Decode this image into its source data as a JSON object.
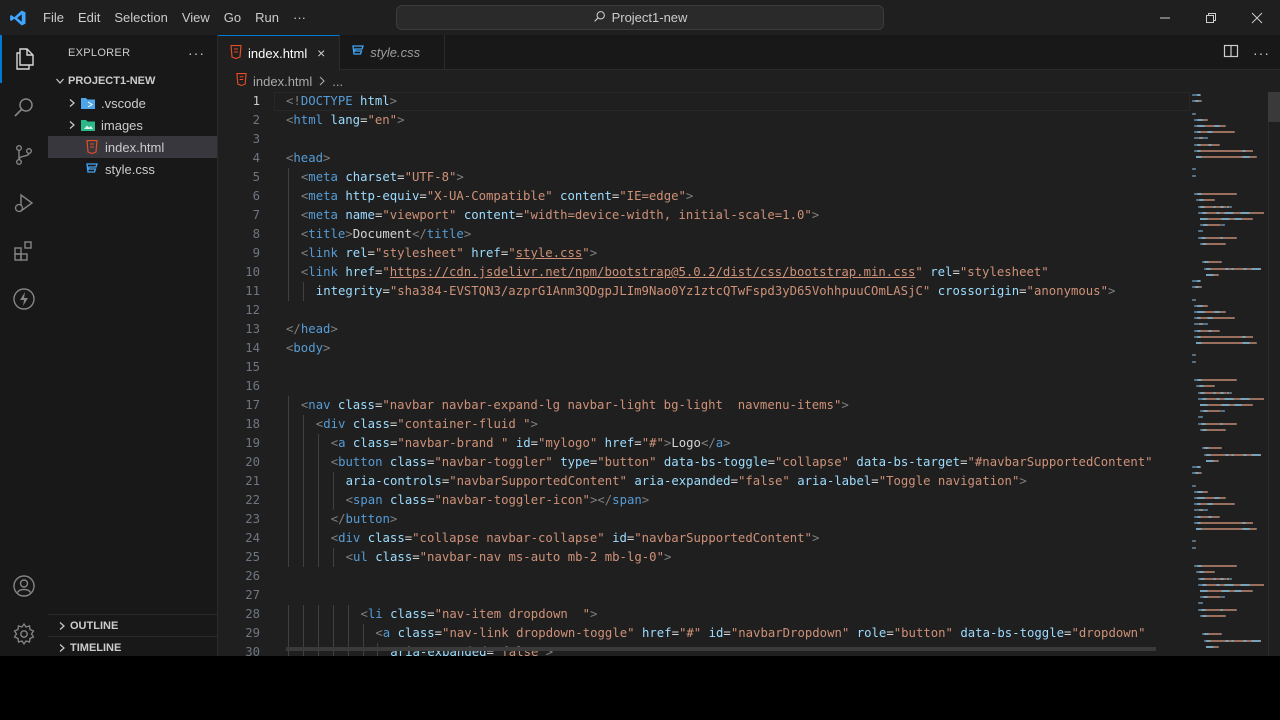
{
  "titlebar": {
    "menu": [
      "File",
      "Edit",
      "Selection",
      "View",
      "Go",
      "Run",
      "···"
    ],
    "search_text": "Project1-new",
    "logo_icon": "vscode-logo",
    "window_controls": [
      "minimize-icon",
      "restore-icon",
      "close-icon"
    ]
  },
  "activity_bar": {
    "items": [
      "explorer-icon",
      "search-icon",
      "source-control-icon",
      "run-debug-icon",
      "extensions-icon",
      "thunder-client-icon"
    ],
    "bottom_items": [
      "accounts-icon",
      "settings-gear-icon"
    ],
    "active_color": "#0078d4"
  },
  "explorer": {
    "title": "EXPLORER",
    "more": "···",
    "folder": "PROJECT1-NEW",
    "items": [
      {
        "label": ".vscode",
        "type": "folder",
        "icon": "vscode-folder-icon"
      },
      {
        "label": "images",
        "type": "folder",
        "icon": "images-folder-icon"
      },
      {
        "label": "index.html",
        "type": "file",
        "icon": "html-file-icon",
        "selected": true
      },
      {
        "label": "style.css",
        "type": "file",
        "icon": "css-file-icon"
      }
    ],
    "outline": "OUTLINE",
    "timeline": "TIMELINE"
  },
  "tabs": [
    {
      "label": "index.html",
      "active": true,
      "close": "×"
    },
    {
      "label": "style.css",
      "active": false
    }
  ],
  "breadcrumb": {
    "file": "index.html",
    "rest": "..."
  },
  "code": {
    "current_line": 1,
    "lines": [
      {
        "n": "1",
        "indent": 0,
        "tokens": [
          [
            "t",
            "<!"
          ],
          [
            "n",
            "DOCTYPE"
          ],
          [
            "x",
            " "
          ],
          [
            "a",
            "html"
          ],
          [
            "t",
            ">"
          ]
        ]
      },
      {
        "n": "2",
        "indent": 0,
        "tokens": [
          [
            "t",
            "<"
          ],
          [
            "n",
            "html"
          ],
          [
            "x",
            " "
          ],
          [
            "a",
            "lang"
          ],
          [
            "x",
            "="
          ],
          [
            "s",
            "\"en\""
          ],
          [
            "t",
            ">"
          ]
        ]
      },
      {
        "n": "3",
        "indent": 0,
        "tokens": []
      },
      {
        "n": "4",
        "indent": 0,
        "tokens": [
          [
            "t",
            "<"
          ],
          [
            "n",
            "head"
          ],
          [
            "t",
            ">"
          ]
        ]
      },
      {
        "n": "5",
        "indent": 1,
        "tokens": [
          [
            "t",
            "<"
          ],
          [
            "n",
            "meta"
          ],
          [
            "x",
            " "
          ],
          [
            "a",
            "charset"
          ],
          [
            "x",
            "="
          ],
          [
            "s",
            "\"UTF-8\""
          ],
          [
            "t",
            ">"
          ]
        ]
      },
      {
        "n": "6",
        "indent": 1,
        "tokens": [
          [
            "t",
            "<"
          ],
          [
            "n",
            "meta"
          ],
          [
            "x",
            " "
          ],
          [
            "a",
            "http-equiv"
          ],
          [
            "x",
            "="
          ],
          [
            "s",
            "\"X-UA-Compatible\""
          ],
          [
            "x",
            " "
          ],
          [
            "a",
            "content"
          ],
          [
            "x",
            "="
          ],
          [
            "s",
            "\"IE=edge\""
          ],
          [
            "t",
            ">"
          ]
        ]
      },
      {
        "n": "7",
        "indent": 1,
        "tokens": [
          [
            "t",
            "<"
          ],
          [
            "n",
            "meta"
          ],
          [
            "x",
            " "
          ],
          [
            "a",
            "name"
          ],
          [
            "x",
            "="
          ],
          [
            "s",
            "\"viewport\""
          ],
          [
            "x",
            " "
          ],
          [
            "a",
            "content"
          ],
          [
            "x",
            "="
          ],
          [
            "s",
            "\"width=device-width, initial-scale=1.0\""
          ],
          [
            "t",
            ">"
          ]
        ]
      },
      {
        "n": "8",
        "indent": 1,
        "tokens": [
          [
            "t",
            "<"
          ],
          [
            "n",
            "title"
          ],
          [
            "t",
            ">"
          ],
          [
            "x",
            "Document"
          ],
          [
            "t",
            "</"
          ],
          [
            "n",
            "title"
          ],
          [
            "t",
            ">"
          ]
        ]
      },
      {
        "n": "9",
        "indent": 1,
        "tokens": [
          [
            "t",
            "<"
          ],
          [
            "n",
            "link"
          ],
          [
            "x",
            " "
          ],
          [
            "a",
            "rel"
          ],
          [
            "x",
            "="
          ],
          [
            "s",
            "\"stylesheet\""
          ],
          [
            "x",
            " "
          ],
          [
            "a",
            "href"
          ],
          [
            "x",
            "="
          ],
          [
            "s",
            "\""
          ],
          [
            "su",
            "style.css"
          ],
          [
            "s",
            "\""
          ],
          [
            "t",
            ">"
          ]
        ]
      },
      {
        "n": "10",
        "indent": 1,
        "tokens": [
          [
            "t",
            "<"
          ],
          [
            "n",
            "link"
          ],
          [
            "x",
            " "
          ],
          [
            "a",
            "href"
          ],
          [
            "x",
            "="
          ],
          [
            "s",
            "\""
          ],
          [
            "su",
            "https://cdn.jsdelivr.net/npm/bootstrap@5.0.2/dist/css/bootstrap.min.css"
          ],
          [
            "s",
            "\""
          ],
          [
            "x",
            " "
          ],
          [
            "a",
            "rel"
          ],
          [
            "x",
            "="
          ],
          [
            "s",
            "\"stylesheet\""
          ]
        ]
      },
      {
        "n": "11",
        "indent": 2,
        "tokens": [
          [
            "a",
            "integrity"
          ],
          [
            "x",
            "="
          ],
          [
            "s",
            "\"sha384-EVSTQN3/azprG1Anm3QDgpJLIm9Nao0Yz1ztcQTwFspd3yD65VohhpuuCOmLASjC\""
          ],
          [
            "x",
            " "
          ],
          [
            "a",
            "crossorigin"
          ],
          [
            "x",
            "="
          ],
          [
            "s",
            "\"anonymous\""
          ],
          [
            "t",
            ">"
          ]
        ]
      },
      {
        "n": "12",
        "indent": 0,
        "tokens": []
      },
      {
        "n": "13",
        "indent": 0,
        "tokens": [
          [
            "t",
            "</"
          ],
          [
            "n",
            "head"
          ],
          [
            "t",
            ">"
          ]
        ]
      },
      {
        "n": "14",
        "indent": 0,
        "tokens": [
          [
            "t",
            "<"
          ],
          [
            "n",
            "body"
          ],
          [
            "t",
            ">"
          ]
        ]
      },
      {
        "n": "15",
        "indent": 0,
        "tokens": []
      },
      {
        "n": "16",
        "indent": 0,
        "tokens": []
      },
      {
        "n": "17",
        "indent": 1,
        "tokens": [
          [
            "t",
            "<"
          ],
          [
            "n",
            "nav"
          ],
          [
            "x",
            " "
          ],
          [
            "a",
            "class"
          ],
          [
            "x",
            "="
          ],
          [
            "s",
            "\"navbar navbar-expand-lg navbar-light bg-light  navmenu-items\""
          ],
          [
            "t",
            ">"
          ]
        ]
      },
      {
        "n": "18",
        "indent": 2,
        "tokens": [
          [
            "t",
            "<"
          ],
          [
            "n",
            "div"
          ],
          [
            "x",
            " "
          ],
          [
            "a",
            "class"
          ],
          [
            "x",
            "="
          ],
          [
            "s",
            "\"container-fluid \""
          ],
          [
            "t",
            ">"
          ]
        ]
      },
      {
        "n": "19",
        "indent": 3,
        "tokens": [
          [
            "t",
            "<"
          ],
          [
            "n",
            "a"
          ],
          [
            "x",
            " "
          ],
          [
            "a",
            "class"
          ],
          [
            "x",
            "="
          ],
          [
            "s",
            "\"navbar-brand \""
          ],
          [
            "x",
            " "
          ],
          [
            "a",
            "id"
          ],
          [
            "x",
            "="
          ],
          [
            "s",
            "\"mylogo\""
          ],
          [
            "x",
            " "
          ],
          [
            "a",
            "href"
          ],
          [
            "x",
            "="
          ],
          [
            "s",
            "\"#\""
          ],
          [
            "t",
            ">"
          ],
          [
            "x",
            "Logo"
          ],
          [
            "t",
            "</"
          ],
          [
            "n",
            "a"
          ],
          [
            "t",
            ">"
          ]
        ]
      },
      {
        "n": "20",
        "indent": 3,
        "tokens": [
          [
            "t",
            "<"
          ],
          [
            "n",
            "button"
          ],
          [
            "x",
            " "
          ],
          [
            "a",
            "class"
          ],
          [
            "x",
            "="
          ],
          [
            "s",
            "\"navbar-toggler\""
          ],
          [
            "x",
            " "
          ],
          [
            "a",
            "type"
          ],
          [
            "x",
            "="
          ],
          [
            "s",
            "\"button\""
          ],
          [
            "x",
            " "
          ],
          [
            "a",
            "data-bs-toggle"
          ],
          [
            "x",
            "="
          ],
          [
            "s",
            "\"collapse\""
          ],
          [
            "x",
            " "
          ],
          [
            "a",
            "data-bs-target"
          ],
          [
            "x",
            "="
          ],
          [
            "s",
            "\"#navbarSupportedContent\""
          ]
        ]
      },
      {
        "n": "21",
        "indent": 4,
        "tokens": [
          [
            "a",
            "aria-controls"
          ],
          [
            "x",
            "="
          ],
          [
            "s",
            "\"navbarSupportedContent\""
          ],
          [
            "x",
            " "
          ],
          [
            "a",
            "aria-expanded"
          ],
          [
            "x",
            "="
          ],
          [
            "s",
            "\"false\""
          ],
          [
            "x",
            " "
          ],
          [
            "a",
            "aria-label"
          ],
          [
            "x",
            "="
          ],
          [
            "s",
            "\"Toggle navigation\""
          ],
          [
            "t",
            ">"
          ]
        ]
      },
      {
        "n": "22",
        "indent": 4,
        "tokens": [
          [
            "t",
            "<"
          ],
          [
            "n",
            "span"
          ],
          [
            "x",
            " "
          ],
          [
            "a",
            "class"
          ],
          [
            "x",
            "="
          ],
          [
            "s",
            "\"navbar-toggler-icon\""
          ],
          [
            "t",
            "></"
          ],
          [
            "n",
            "span"
          ],
          [
            "t",
            ">"
          ]
        ]
      },
      {
        "n": "23",
        "indent": 3,
        "tokens": [
          [
            "t",
            "</"
          ],
          [
            "n",
            "button"
          ],
          [
            "t",
            ">"
          ]
        ]
      },
      {
        "n": "24",
        "indent": 3,
        "tokens": [
          [
            "t",
            "<"
          ],
          [
            "n",
            "div"
          ],
          [
            "x",
            " "
          ],
          [
            "a",
            "class"
          ],
          [
            "x",
            "="
          ],
          [
            "s",
            "\"collapse navbar-collapse\""
          ],
          [
            "x",
            " "
          ],
          [
            "a",
            "id"
          ],
          [
            "x",
            "="
          ],
          [
            "s",
            "\"navbarSupportedContent\""
          ],
          [
            "t",
            ">"
          ]
        ]
      },
      {
        "n": "25",
        "indent": 4,
        "tokens": [
          [
            "t",
            "<"
          ],
          [
            "n",
            "ul"
          ],
          [
            "x",
            " "
          ],
          [
            "a",
            "class"
          ],
          [
            "x",
            "="
          ],
          [
            "s",
            "\"navbar-nav ms-auto mb-2 mb-lg-0\""
          ],
          [
            "t",
            ">"
          ]
        ]
      },
      {
        "n": "26",
        "indent": 0,
        "tokens": []
      },
      {
        "n": "27",
        "indent": 0,
        "tokens": []
      },
      {
        "n": "28",
        "indent": 5,
        "tokens": [
          [
            "t",
            "<"
          ],
          [
            "n",
            "li"
          ],
          [
            "x",
            " "
          ],
          [
            "a",
            "class"
          ],
          [
            "x",
            "="
          ],
          [
            "s",
            "\"nav-item dropdown  \""
          ],
          [
            "t",
            ">"
          ]
        ]
      },
      {
        "n": "29",
        "indent": 6,
        "tokens": [
          [
            "t",
            "<"
          ],
          [
            "n",
            "a"
          ],
          [
            "x",
            " "
          ],
          [
            "a",
            "class"
          ],
          [
            "x",
            "="
          ],
          [
            "s",
            "\"nav-link dropdown-toggle\""
          ],
          [
            "x",
            " "
          ],
          [
            "a",
            "href"
          ],
          [
            "x",
            "="
          ],
          [
            "s",
            "\"#\""
          ],
          [
            "x",
            " "
          ],
          [
            "a",
            "id"
          ],
          [
            "x",
            "="
          ],
          [
            "s",
            "\"navbarDropdown\""
          ],
          [
            "x",
            " "
          ],
          [
            "a",
            "role"
          ],
          [
            "x",
            "="
          ],
          [
            "s",
            "\"button\""
          ],
          [
            "x",
            " "
          ],
          [
            "a",
            "data-bs-toggle"
          ],
          [
            "x",
            "="
          ],
          [
            "s",
            "\"dropdown\""
          ]
        ]
      },
      {
        "n": "30",
        "indent": 7,
        "tokens": [
          [
            "a",
            "aria-expanded"
          ],
          [
            "x",
            "="
          ],
          [
            "s",
            "\"false\""
          ],
          [
            "t",
            ">"
          ]
        ]
      }
    ]
  }
}
